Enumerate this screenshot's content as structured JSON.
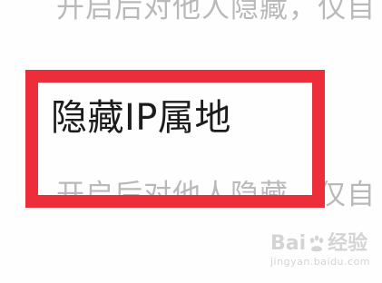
{
  "settings": {
    "description_text": "开启后对他人隐藏，仅自",
    "hide_ip_label": "隐藏IP属地"
  },
  "colors": {
    "highlight": "#ee2d3a",
    "label": "#1c1c1c",
    "description": "#b9b9b9",
    "watermark": "#d4d4d4"
  },
  "watermark": {
    "brand_left": "Bai",
    "brand_right": "经验",
    "url": "jingyan.baidu.com",
    "icon": "baidu-paw-icon"
  }
}
